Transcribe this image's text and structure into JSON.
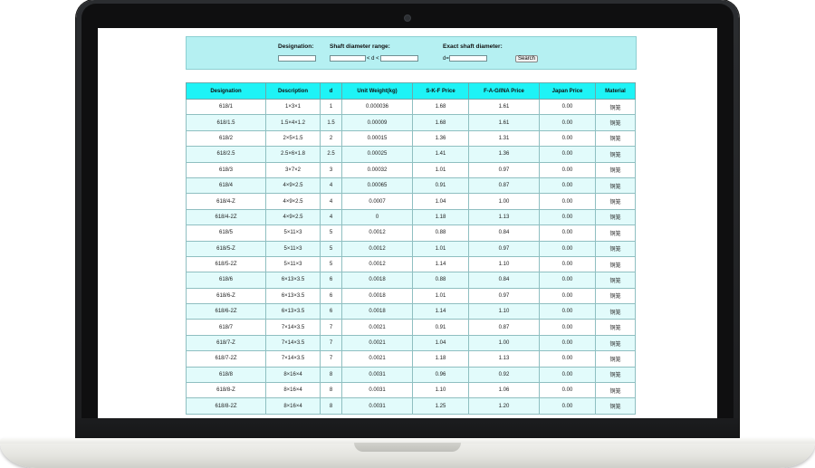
{
  "search": {
    "designation_label": "Designation:",
    "range_label": "Shaft diameter range:",
    "range_mid": "< d <",
    "exact_label": "Exact shaft diameter:",
    "exact_prefix": "d=",
    "button_label": "Search"
  },
  "table": {
    "headers": [
      "Designation",
      "Description",
      "d",
      "Unit Weight(kg)",
      "S-K-F Price",
      "F-A-G/INA Price",
      "Japan Price",
      "Material"
    ],
    "rows": [
      [
        "618/1",
        "1×3×1",
        "1",
        "0.000036",
        "1.68",
        "1.61",
        "0.00",
        "铜笼"
      ],
      [
        "618/1.5",
        "1.5×4×1.2",
        "1.5",
        "0.00009",
        "1.68",
        "1.61",
        "0.00",
        "铜笼"
      ],
      [
        "618/2",
        "2×5×1.5",
        "2",
        "0.00015",
        "1.36",
        "1.31",
        "0.00",
        "铜笼"
      ],
      [
        "618/2.5",
        "2.5×6×1.8",
        "2.5",
        "0.00025",
        "1.41",
        "1.36",
        "0.00",
        "铜笼"
      ],
      [
        "618/3",
        "3×7×2",
        "3",
        "0.00032",
        "1.01",
        "0.97",
        "0.00",
        "铜笼"
      ],
      [
        "618/4",
        "4×9×2.5",
        "4",
        "0.00065",
        "0.91",
        "0.87",
        "0.00",
        "铜笼"
      ],
      [
        "618/4-Z",
        "4×9×2.5",
        "4",
        "0.0007",
        "1.04",
        "1.00",
        "0.00",
        "铜笼"
      ],
      [
        "618/4-2Z",
        "4×9×2.5",
        "4",
        "0",
        "1.18",
        "1.13",
        "0.00",
        "铜笼"
      ],
      [
        "618/5",
        "5×11×3",
        "5",
        "0.0012",
        "0.88",
        "0.84",
        "0.00",
        "铜笼"
      ],
      [
        "618/5-Z",
        "5×11×3",
        "5",
        "0.0012",
        "1.01",
        "0.97",
        "0.00",
        "铜笼"
      ],
      [
        "618/5-2Z",
        "5×11×3",
        "5",
        "0.0012",
        "1.14",
        "1.10",
        "0.00",
        "铜笼"
      ],
      [
        "618/6",
        "6×13×3.5",
        "6",
        "0.0018",
        "0.88",
        "0.84",
        "0.00",
        "铜笼"
      ],
      [
        "618/6-Z",
        "6×13×3.5",
        "6",
        "0.0018",
        "1.01",
        "0.97",
        "0.00",
        "铜笼"
      ],
      [
        "618/6-2Z",
        "6×13×3.5",
        "6",
        "0.0018",
        "1.14",
        "1.10",
        "0.00",
        "铜笼"
      ],
      [
        "618/7",
        "7×14×3.5",
        "7",
        "0.0021",
        "0.91",
        "0.87",
        "0.00",
        "铜笼"
      ],
      [
        "618/7-Z",
        "7×14×3.5",
        "7",
        "0.0021",
        "1.04",
        "1.00",
        "0.00",
        "铜笼"
      ],
      [
        "618/7-2Z",
        "7×14×3.5",
        "7",
        "0.0021",
        "1.18",
        "1.13",
        "0.00",
        "铜笼"
      ],
      [
        "618/8",
        "8×16×4",
        "8",
        "0.0031",
        "0.96",
        "0.92",
        "0.00",
        "铜笼"
      ],
      [
        "618/8-Z",
        "8×16×4",
        "8",
        "0.0031",
        "1.10",
        "1.06",
        "0.00",
        "铜笼"
      ],
      [
        "618/8-2Z",
        "8×16×4",
        "8",
        "0.0031",
        "1.25",
        "1.20",
        "0.00",
        "铜笼"
      ]
    ]
  },
  "colors": {
    "header_bg": "#1ef3f6",
    "panel_bg": "#b5f0f2",
    "row_alt": "#e2fbfb"
  }
}
